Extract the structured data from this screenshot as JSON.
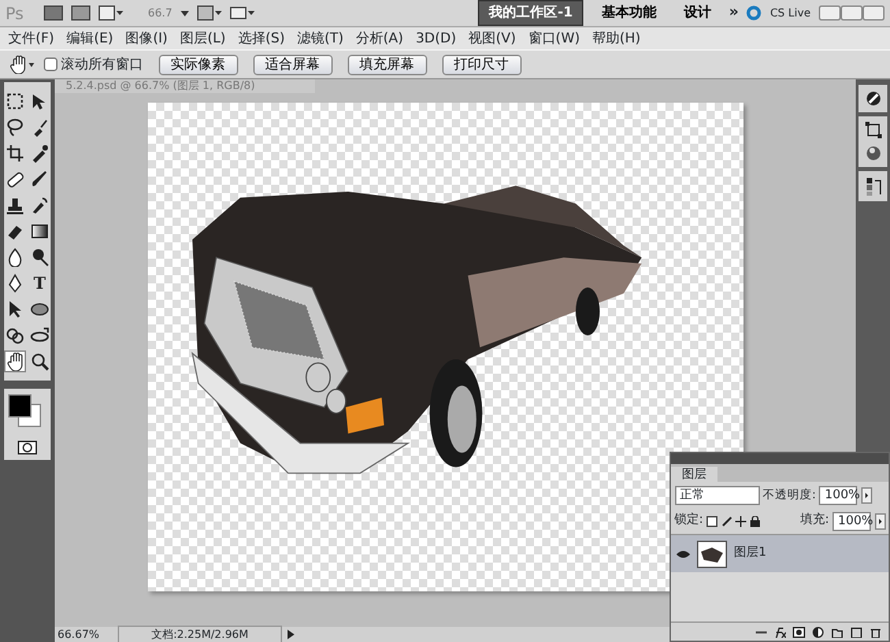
{
  "app_bar": {
    "logo": "Ps",
    "zoom": "66.7",
    "workspaces": [
      {
        "label": "我的工作区-1",
        "selected": true
      },
      {
        "label": "基本功能",
        "selected": false
      },
      {
        "label": "设计",
        "selected": false
      }
    ],
    "more": "»",
    "cs_live": "CS Live"
  },
  "menu": [
    "文件(F)",
    "编辑(E)",
    "图像(I)",
    "图层(L)",
    "选择(S)",
    "滤镜(T)",
    "分析(A)",
    "3D(D)",
    "视图(V)",
    "窗口(W)",
    "帮助(H)"
  ],
  "options_bar": {
    "scroll_all": {
      "label": "滚动所有窗口",
      "checked": false
    },
    "buttons": [
      "实际像素",
      "适合屏幕",
      "填充屏幕",
      "打印尺寸"
    ]
  },
  "tools": [
    {
      "kind": "marquee",
      "selected": false
    },
    {
      "kind": "move",
      "selected": false
    },
    {
      "kind": "lasso",
      "selected": false
    },
    {
      "kind": "quick-select",
      "selected": false
    },
    {
      "kind": "crop",
      "selected": false
    },
    {
      "kind": "eyedropper",
      "selected": false
    },
    {
      "kind": "bandage",
      "selected": false
    },
    {
      "kind": "brush",
      "selected": false
    },
    {
      "kind": "stamp",
      "selected": false
    },
    {
      "kind": "history",
      "selected": false
    },
    {
      "kind": "eraser",
      "selected": false
    },
    {
      "kind": "gradient",
      "selected": false
    },
    {
      "kind": "drop",
      "selected": false
    },
    {
      "kind": "dodge",
      "selected": false
    },
    {
      "kind": "pen",
      "selected": false
    },
    {
      "kind": "type",
      "selected": false,
      "glyph": "T"
    },
    {
      "kind": "arrow",
      "selected": false
    },
    {
      "kind": "ellipse",
      "selected": false
    },
    {
      "kind": "rotate3d",
      "selected": false
    },
    {
      "kind": "orbit3d",
      "selected": false
    },
    {
      "kind": "hand",
      "selected": true
    },
    {
      "kind": "zoom",
      "selected": false
    }
  ],
  "document": {
    "tab": "5.2.4.psd @ 66.7% (图层 1, RGB/8)"
  },
  "layers_panel": {
    "tab": "图层",
    "blend_mode": "正常",
    "opacity_label": "不透明度:",
    "opacity": "100%",
    "lock_label": "锁定:",
    "fill_label": "填充:",
    "fill": "100%",
    "layers": [
      {
        "name": "图层1",
        "visible": true,
        "selected": true
      }
    ]
  },
  "status_bar": {
    "zoom": "66.67%",
    "doc_info": "文档:2.25M/2.96M"
  }
}
